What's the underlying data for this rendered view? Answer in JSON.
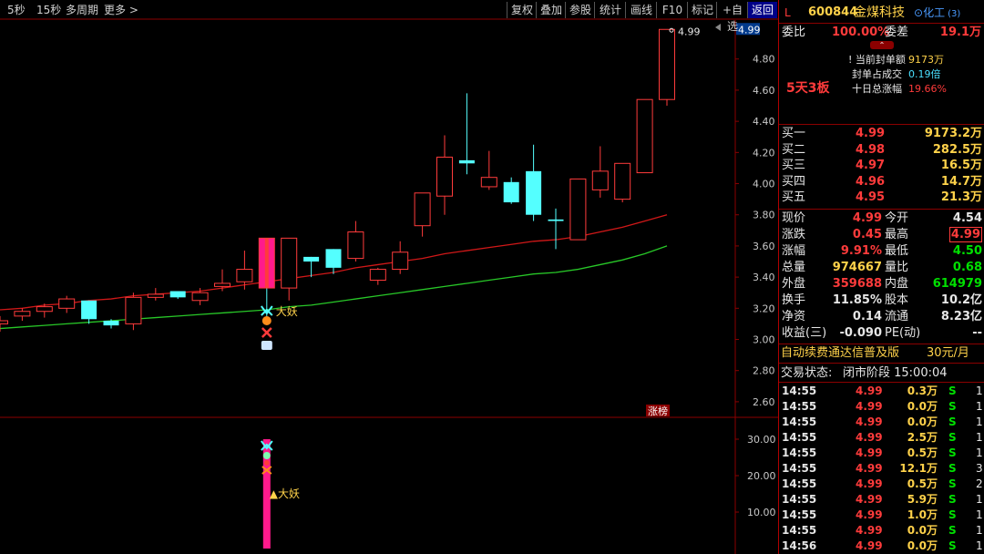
{
  "toolbar_left": [
    {
      "label": "5秒"
    },
    {
      "label": "15秒"
    },
    {
      "label": "多周期"
    },
    {
      "label": "更多 >"
    }
  ],
  "toolbar_right": [
    {
      "label": "复权"
    },
    {
      "label": "叠加"
    },
    {
      "label": "参股"
    },
    {
      "label": "统计"
    },
    {
      "label": "画线"
    },
    {
      "label": "F10"
    },
    {
      "label": "标记"
    },
    {
      "label": "+自选"
    },
    {
      "label": "返回"
    }
  ],
  "chart": {
    "price_axis": [
      "4.80",
      "4.60",
      "4.40",
      "4.20",
      "4.00",
      "3.80",
      "3.60",
      "3.40",
      "3.20",
      "3.00",
      "2.80",
      "2.60"
    ],
    "current_price_tag": "4.99",
    "high_label": "4.99",
    "lower_axis": [
      "30.00",
      "20.00",
      "10.00"
    ],
    "signal_label_top": "大妖",
    "signal_label_bottom": "▲大妖",
    "zhangting_tag": "涨榜",
    "colors": {
      "up": "#ff3b3b",
      "down": "#54ffff",
      "ma1": "#d01818",
      "ma2": "#28c828",
      "signal": "#ff1a8c"
    }
  },
  "chart_data": {
    "type": "candlestick",
    "ylim": [
      2.5,
      5.05
    ],
    "candles": [
      {
        "o": 3.1,
        "h": 3.15,
        "l": 3.05,
        "c": 3.12
      },
      {
        "o": 3.15,
        "h": 3.2,
        "l": 3.12,
        "c": 3.18
      },
      {
        "o": 3.18,
        "h": 3.23,
        "l": 3.14,
        "c": 3.21
      },
      {
        "o": 3.2,
        "h": 3.28,
        "l": 3.17,
        "c": 3.26
      },
      {
        "o": 3.25,
        "h": 3.25,
        "l": 3.1,
        "c": 3.13
      },
      {
        "o": 3.12,
        "h": 3.13,
        "l": 3.07,
        "c": 3.09
      },
      {
        "o": 3.1,
        "h": 3.3,
        "l": 3.06,
        "c": 3.27
      },
      {
        "o": 3.27,
        "h": 3.33,
        "l": 3.25,
        "c": 3.29
      },
      {
        "o": 3.31,
        "h": 3.31,
        "l": 3.26,
        "c": 3.27
      },
      {
        "o": 3.25,
        "h": 3.33,
        "l": 3.22,
        "c": 3.3
      },
      {
        "o": 3.34,
        "h": 3.45,
        "l": 3.31,
        "c": 3.36
      },
      {
        "o": 3.37,
        "h": 3.57,
        "l": 3.32,
        "c": 3.45
      },
      {
        "o": 3.39,
        "h": 3.39,
        "l": 3.13,
        "c": 3.33
      },
      {
        "o": 3.33,
        "h": 3.65,
        "l": 3.25,
        "c": 3.65
      },
      {
        "o": 3.53,
        "h": 3.53,
        "l": 3.4,
        "c": 3.5
      },
      {
        "o": 3.58,
        "h": 3.58,
        "l": 3.42,
        "c": 3.46
      },
      {
        "o": 3.52,
        "h": 3.76,
        "l": 3.5,
        "c": 3.69
      },
      {
        "o": 3.38,
        "h": 3.46,
        "l": 3.35,
        "c": 3.45
      },
      {
        "o": 3.45,
        "h": 3.63,
        "l": 3.42,
        "c": 3.56
      },
      {
        "o": 3.73,
        "h": 3.89,
        "l": 3.66,
        "c": 3.94
      },
      {
        "o": 3.92,
        "h": 4.31,
        "l": 3.8,
        "c": 4.17
      },
      {
        "o": 4.15,
        "h": 4.58,
        "l": 4.06,
        "c": 4.13
      },
      {
        "o": 3.98,
        "h": 4.21,
        "l": 3.96,
        "c": 4.04
      },
      {
        "o": 4.01,
        "h": 4.04,
        "l": 3.87,
        "c": 3.88
      },
      {
        "o": 4.08,
        "h": 4.25,
        "l": 3.76,
        "c": 3.8
      },
      {
        "o": 3.77,
        "h": 3.84,
        "l": 3.58,
        "c": 3.76
      },
      {
        "o": 3.64,
        "h": 3.64,
        "l": 3.64,
        "c": 4.03
      },
      {
        "o": 3.96,
        "h": 4.24,
        "l": 3.91,
        "c": 4.08
      },
      {
        "o": 3.9,
        "h": 4.13,
        "l": 3.88,
        "c": 4.13
      },
      {
        "o": 4.07,
        "h": 4.45,
        "l": 4.07,
        "c": 4.54
      },
      {
        "o": 4.54,
        "h": 4.99,
        "l": 4.5,
        "c": 4.99
      }
    ],
    "ma1": [
      3.19,
      3.2,
      3.22,
      3.23,
      3.25,
      3.26,
      3.28,
      3.29,
      3.3,
      3.31,
      3.33,
      3.35,
      3.37,
      3.39,
      3.41,
      3.43,
      3.46,
      3.48,
      3.5,
      3.52,
      3.55,
      3.57,
      3.59,
      3.61,
      3.63,
      3.64,
      3.66,
      3.69,
      3.72,
      3.76,
      3.8
    ],
    "ma2": [
      3.07,
      3.08,
      3.09,
      3.1,
      3.11,
      3.12,
      3.13,
      3.14,
      3.15,
      3.16,
      3.17,
      3.18,
      3.19,
      3.21,
      3.22,
      3.24,
      3.26,
      3.28,
      3.3,
      3.32,
      3.34,
      3.36,
      3.38,
      3.4,
      3.42,
      3.43,
      3.45,
      3.48,
      3.51,
      3.55,
      3.6
    ],
    "signal_value": 30,
    "signal_index": 12,
    "lower_ylim": [
      0,
      36
    ]
  },
  "panel": {
    "code_prefix": "L",
    "code": "600844",
    "name": "金煤科技",
    "sector": "化工",
    "sector_count": "(3)",
    "weibi_label": "委比",
    "weibi_value": "100.00%",
    "weicha_label": "委差",
    "weicha_value": "19.1万",
    "info": [
      {
        "label": "! 当前封单额",
        "value": "9173万",
        "cls": "yellow"
      },
      {
        "label": "封单占成交",
        "value": "0.19倍",
        "cls": "cyan"
      },
      {
        "label": "十日总涨幅",
        "value": "19.66%",
        "cls": "red"
      }
    ],
    "board_tag": "5天3板",
    "bids": [
      {
        "label": "买一",
        "price": "4.99",
        "vol": "9173.2万"
      },
      {
        "label": "买二",
        "price": "4.98",
        "vol": "282.5万"
      },
      {
        "label": "买三",
        "price": "4.97",
        "vol": "16.5万"
      },
      {
        "label": "买四",
        "price": "4.96",
        "vol": "14.7万"
      },
      {
        "label": "买五",
        "price": "4.95",
        "vol": "21.3万"
      }
    ],
    "quote": [
      {
        "l1": "现价",
        "v1": "4.99",
        "c1": "red",
        "l2": "今开",
        "v2": "4.54",
        "c2": "white"
      },
      {
        "l1": "涨跌",
        "v1": "0.45",
        "c1": "red",
        "l2": "最高",
        "v2": "4.99",
        "c2": "red"
      },
      {
        "l1": "涨幅",
        "v1": "9.91%",
        "c1": "red",
        "l2": "最低",
        "v2": "4.50",
        "c2": "green"
      },
      {
        "l1": "总量",
        "v1": "974667",
        "c1": "yellow",
        "l2": "量比",
        "v2": "0.68",
        "c2": "green"
      },
      {
        "l1": "外盘",
        "v1": "359688",
        "c1": "red",
        "l2": "内盘",
        "v2": "614979",
        "c2": "green"
      },
      {
        "l1": "换手",
        "v1": "11.85%",
        "c1": "white",
        "l2": "股本",
        "v2": "10.2亿",
        "c2": "white"
      },
      {
        "l1": "净资",
        "v1": "0.14",
        "c1": "white",
        "l2": "流通",
        "v2": "8.23亿",
        "c2": "white"
      },
      {
        "l1": "收益(三)",
        "v1": "-0.090",
        "c1": "white",
        "l2": "PE(动)",
        "v2": "--",
        "c2": "white"
      }
    ],
    "promo": "自动续费通达信普及版",
    "promo_price": "30元/月",
    "status_label": "交易状态:",
    "status_value": "闭市阶段 15:00:04",
    "ticks": [
      {
        "t": "14:55",
        "p": "4.99",
        "v": "0.3万",
        "s": "S",
        "n": "1"
      },
      {
        "t": "14:55",
        "p": "4.99",
        "v": "0.0万",
        "s": "S",
        "n": "1"
      },
      {
        "t": "14:55",
        "p": "4.99",
        "v": "0.0万",
        "s": "S",
        "n": "1"
      },
      {
        "t": "14:55",
        "p": "4.99",
        "v": "2.5万",
        "s": "S",
        "n": "1"
      },
      {
        "t": "14:55",
        "p": "4.99",
        "v": "0.5万",
        "s": "S",
        "n": "1"
      },
      {
        "t": "14:55",
        "p": "4.99",
        "v": "12.1万",
        "s": "S",
        "n": "3"
      },
      {
        "t": "14:55",
        "p": "4.99",
        "v": "0.5万",
        "s": "S",
        "n": "2"
      },
      {
        "t": "14:55",
        "p": "4.99",
        "v": "5.9万",
        "s": "S",
        "n": "1"
      },
      {
        "t": "14:55",
        "p": "4.99",
        "v": "1.0万",
        "s": "S",
        "n": "1"
      },
      {
        "t": "14:55",
        "p": "4.99",
        "v": "0.0万",
        "s": "S",
        "n": "1"
      },
      {
        "t": "14:56",
        "p": "4.99",
        "v": "0.0万",
        "s": "S",
        "n": "1"
      }
    ]
  }
}
